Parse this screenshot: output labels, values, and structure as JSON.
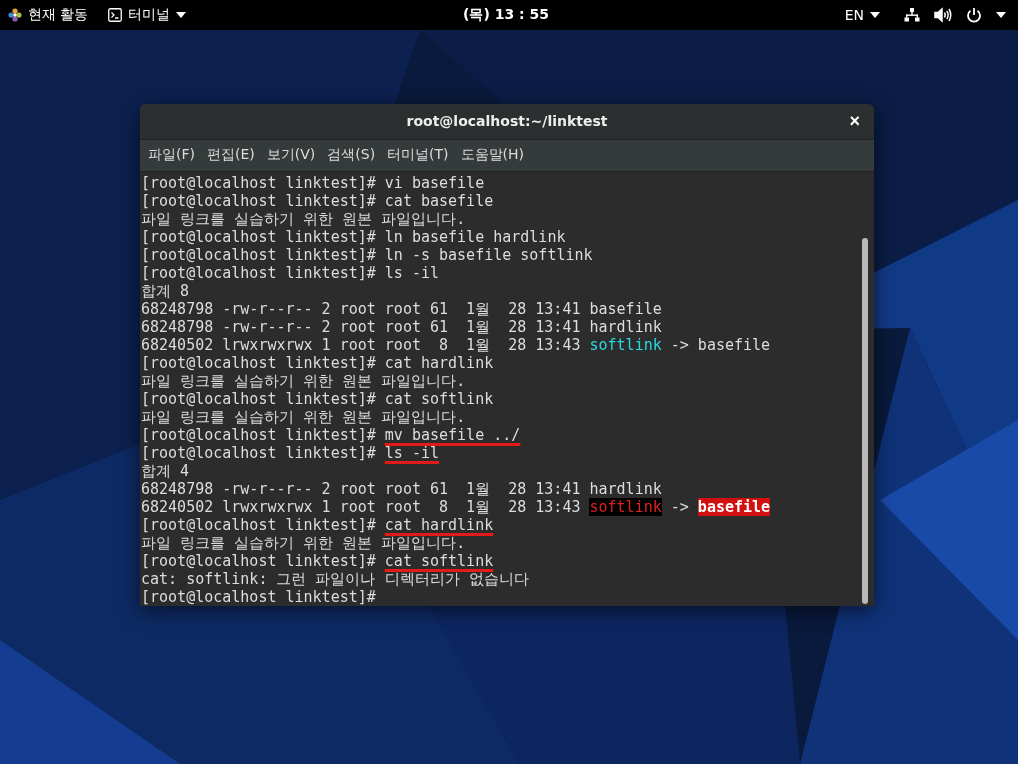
{
  "top_bar": {
    "activities": "현재 활동",
    "app_menu": "터미널",
    "clock": "(목) 13 : 55",
    "language": "EN"
  },
  "window": {
    "title": "root@localhost:~/linktest",
    "close": "×"
  },
  "menu": [
    "파일(F)",
    "편집(E)",
    "보기(V)",
    "검색(S)",
    "터미널(T)",
    "도움말(H)"
  ],
  "terminal": [
    [
      {
        "text": "[root@localhost linktest]# ",
        "kind": "prompt",
        "underlined": false
      },
      {
        "text": "vi basefile",
        "kind": "command",
        "underlined": false
      }
    ],
    [
      {
        "text": "[root@localhost linktest]# ",
        "kind": "prompt",
        "underlined": false
      },
      {
        "text": "cat basefile",
        "kind": "command",
        "underlined": false
      }
    ],
    [
      {
        "text": "파일 링크를 실습하기 위한 원본 파일입니다.",
        "kind": "output",
        "underlined": false
      }
    ],
    [
      {
        "text": "[root@localhost linktest]# ",
        "kind": "prompt",
        "underlined": false
      },
      {
        "text": "ln basefile hardlink",
        "kind": "command",
        "underlined": false
      }
    ],
    [
      {
        "text": "[root@localhost linktest]# ",
        "kind": "prompt",
        "underlined": false
      },
      {
        "text": "ln -s basefile softlink",
        "kind": "command",
        "underlined": false
      }
    ],
    [
      {
        "text": "[root@localhost linktest]# ",
        "kind": "prompt",
        "underlined": false
      },
      {
        "text": "ls -il",
        "kind": "command",
        "underlined": false
      }
    ],
    [
      {
        "text": "합계 8",
        "kind": "output",
        "underlined": false
      }
    ],
    [
      {
        "text": "68248798 -rw-r--r-- 2 root root 61  1월  28 13:41 basefile",
        "kind": "output",
        "underlined": false
      }
    ],
    [
      {
        "text": "68248798 -rw-r--r-- 2 root root 61  1월  28 13:41 hardlink",
        "kind": "output",
        "underlined": false
      }
    ],
    [
      {
        "text": "68240502 lrwxrwxrwx 1 root root  8  1월  28 13:43 ",
        "kind": "output",
        "underlined": false
      },
      {
        "text": "softlink",
        "kind": "symlink",
        "underlined": false
      },
      {
        "text": " -> basefile",
        "kind": "output",
        "underlined": false
      }
    ],
    [
      {
        "text": "[root@localhost linktest]# ",
        "kind": "prompt",
        "underlined": false
      },
      {
        "text": "cat hardlink",
        "kind": "command",
        "underlined": false
      }
    ],
    [
      {
        "text": "파일 링크를 실습하기 위한 원본 파일입니다.",
        "kind": "output",
        "underlined": false
      }
    ],
    [
      {
        "text": "[root@localhost linktest]# ",
        "kind": "prompt",
        "underlined": false
      },
      {
        "text": "cat softlink",
        "kind": "command",
        "underlined": false
      }
    ],
    [
      {
        "text": "파일 링크를 실습하기 위한 원본 파일입니다.",
        "kind": "output",
        "underlined": false
      }
    ],
    [
      {
        "text": "[root@localhost linktest]# ",
        "kind": "prompt",
        "underlined": false
      },
      {
        "text": "mv basefile ../",
        "kind": "command",
        "underlined": true
      }
    ],
    [
      {
        "text": "[root@localhost linktest]# ",
        "kind": "prompt",
        "underlined": false
      },
      {
        "text": "ls -il",
        "kind": "command",
        "underlined": true
      }
    ],
    [
      {
        "text": "합계 4",
        "kind": "output",
        "underlined": false
      }
    ],
    [
      {
        "text": "68248798 -rw-r--r-- 2 root root 61  1월  28 13:41 hardlink",
        "kind": "output",
        "underlined": false
      }
    ],
    [
      {
        "text": "68240502 lrwxrwxrwx 1 root root  8  1월  28 13:43 ",
        "kind": "output",
        "underlined": false
      },
      {
        "text": "softlink",
        "kind": "broken-symlink",
        "underlined": false
      },
      {
        "text": " -> ",
        "kind": "output",
        "underlined": false
      },
      {
        "text": "basefile",
        "kind": "missing-target",
        "underlined": false
      }
    ],
    [
      {
        "text": "[root@localhost linktest]# ",
        "kind": "prompt",
        "underlined": false
      },
      {
        "text": "cat hardlink",
        "kind": "command",
        "underlined": true
      }
    ],
    [
      {
        "text": "파일 링크를 실습하기 위한 원본 파일입니다.",
        "kind": "output",
        "underlined": false
      }
    ],
    [
      {
        "text": "[root@localhost linktest]# ",
        "kind": "prompt",
        "underlined": false
      },
      {
        "text": "cat softlink",
        "kind": "command",
        "underlined": true
      }
    ],
    [
      {
        "text": "cat: softlink: 그런 파일이나 디렉터리가 없습니다",
        "kind": "output",
        "underlined": false
      }
    ],
    [
      {
        "text": "[root@localhost linktest]#",
        "kind": "prompt",
        "underlined": false
      }
    ]
  ]
}
